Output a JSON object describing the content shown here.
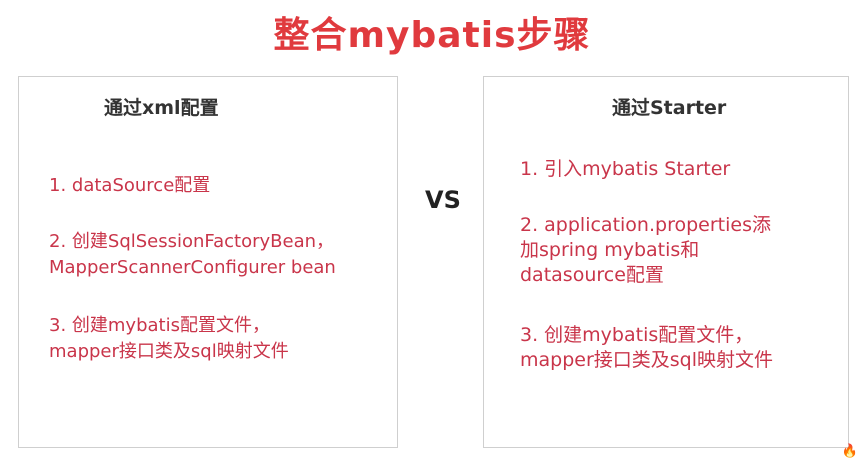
{
  "title": "整合mybatis步骤",
  "left": {
    "heading": "通过xml配置",
    "items": [
      [
        "1. dataSource配置"
      ],
      [
        "2. 创建SqlSessionFactoryBean，",
        "MapperScannerConfigurer bean"
      ],
      [
        "3. 创建mybatis配置文件，",
        " mapper接口类及sql映射文件"
      ]
    ]
  },
  "vs": "VS",
  "right": {
    "heading": "通过Starter",
    "items": [
      [
        "1. 引入mybatis Starter"
      ],
      [
        "2.  application.properties添",
        "加spring mybatis和",
        "datasource配置"
      ],
      [
        "3.  创建mybatis配置文件，",
        "mapper接口类及sql映射文件"
      ]
    ]
  },
  "colors": {
    "title": "#e03a3e",
    "item": "#c9354a"
  },
  "watermark_icon": "flame-logo-icon"
}
